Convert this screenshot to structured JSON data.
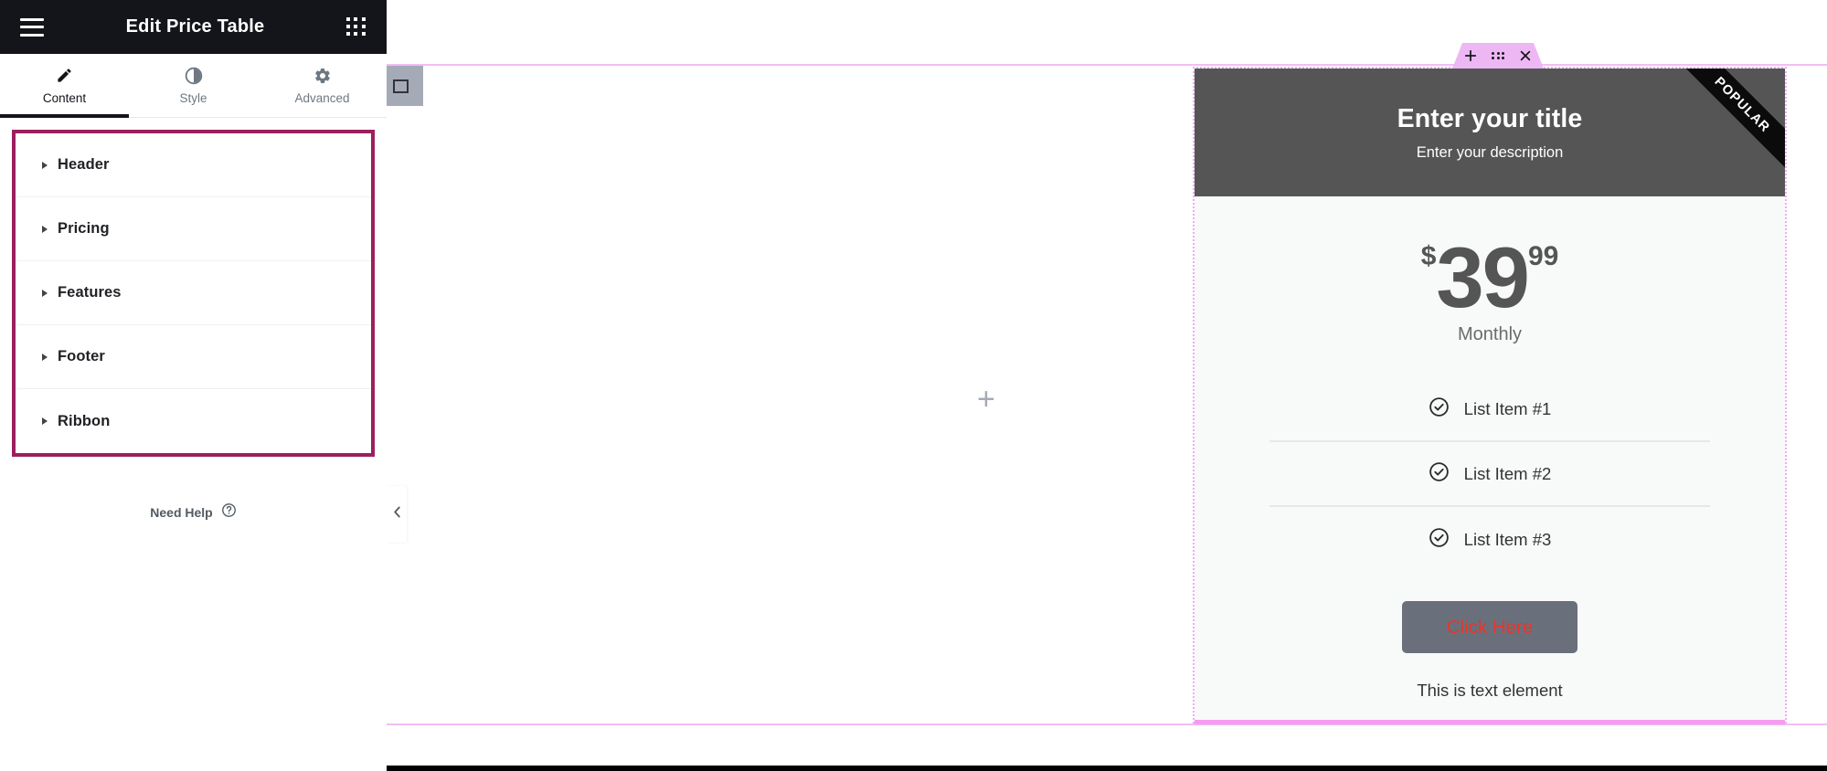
{
  "panel": {
    "header": {
      "title": "Edit Price Table",
      "menu_icon": "hamburger-icon",
      "widgets_icon": "grid-icon"
    },
    "tabs": [
      {
        "label": "Content",
        "icon": "pencil-icon",
        "active": true
      },
      {
        "label": "Style",
        "icon": "contrast-icon",
        "active": false
      },
      {
        "label": "Advanced",
        "icon": "gear-icon",
        "active": false
      }
    ],
    "accordion": {
      "highlight_color": "#9c1f5e",
      "items": [
        {
          "label": "Header"
        },
        {
          "label": "Pricing"
        },
        {
          "label": "Features"
        },
        {
          "label": "Footer"
        },
        {
          "label": "Ribbon"
        }
      ]
    },
    "need_help": {
      "label": "Need Help",
      "icon": "question-circle-icon"
    },
    "collapse": {
      "icon": "chevron-left-icon"
    }
  },
  "canvas": {
    "add_section_plus_left": "+",
    "add_section_plus_right": "+",
    "section_handle_icon": "column-handle-icon",
    "section_border_color": "#f3bdf5"
  },
  "widget": {
    "toolbar": {
      "add_icon": "plus-icon",
      "drag_icon": "drag-dots-icon",
      "close_icon": "close-icon",
      "background_color": "#edb7f4"
    },
    "selection_color": "#f3a9f3",
    "header": {
      "title": "Enter your title",
      "description": "Enter your description",
      "background_color": "#555555"
    },
    "ribbon": {
      "text": "POPULAR",
      "background_color": "#0b0b0b"
    },
    "pricing": {
      "currency": "$",
      "integer": "39",
      "fraction": "99",
      "period": "Monthly",
      "color": "#555555"
    },
    "features": [
      {
        "label": "List Item #1",
        "icon": "check-circle-icon",
        "divider": true
      },
      {
        "label": "List Item #2",
        "icon": "check-circle-icon",
        "divider": true
      },
      {
        "label": "List Item #3",
        "icon": "check-circle-icon",
        "divider": false
      }
    ],
    "footer": {
      "button_label": "Click Here",
      "button_background": "#69707c",
      "button_text_color": "#e8352c",
      "text": "This is text element"
    }
  }
}
